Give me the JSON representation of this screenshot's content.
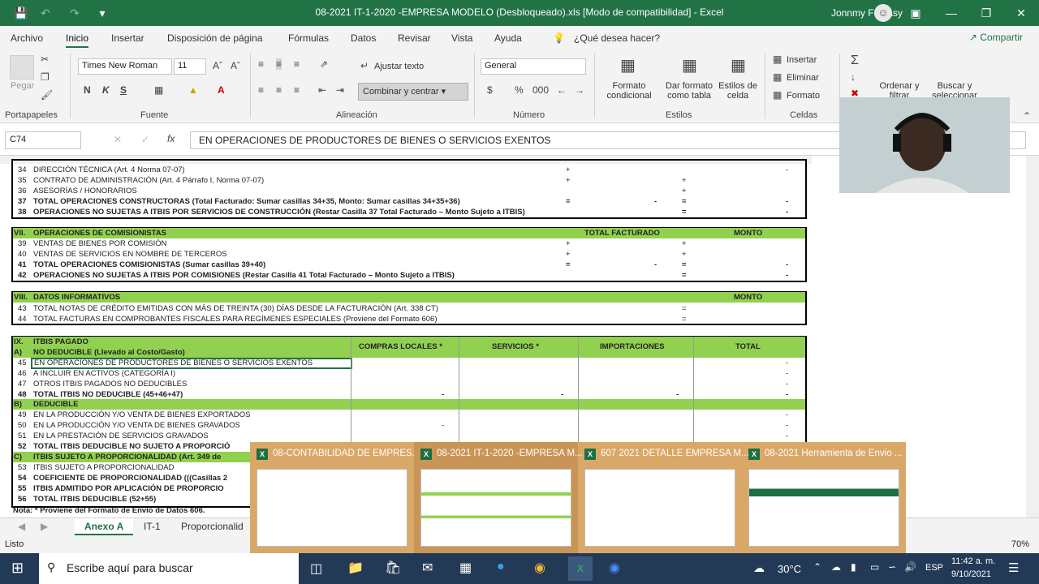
{
  "window": {
    "title": "08-2021 IT-1-2020 -EMPRESA MODELO  (Desbloqueado).xls  [Modo de compatibilidad]  -  Excel",
    "user": "Jonnmy Fantasy"
  },
  "menu": {
    "tabs": [
      "Archivo",
      "Inicio",
      "Insertar",
      "Disposición de página",
      "Fórmulas",
      "Datos",
      "Revisar",
      "Vista",
      "Ayuda"
    ],
    "active": "Inicio",
    "tell_me": "¿Qué desea hacer?",
    "share": "Compartir"
  },
  "ribbon": {
    "clipboard": {
      "paste": "Pegar",
      "label": "Portapapeles"
    },
    "font": {
      "name": "Times New Roman",
      "size": "11",
      "label": "Fuente",
      "bold": "N",
      "italic": "K",
      "underline": "S"
    },
    "alignment": {
      "wrap": "Ajustar texto",
      "merge": "Combinar y centrar",
      "label": "Alineación"
    },
    "number": {
      "format": "General",
      "label": "Número",
      "currency": "$",
      "percent": "%",
      "thousands": "000"
    },
    "styles": {
      "conditional": "Formato condicional",
      "table": "Dar formato como tabla",
      "cell": "Estilos de celda",
      "label": "Estilos"
    },
    "cells": {
      "insert": "Insertar",
      "delete": "Eliminar",
      "format": "Formato",
      "label": "Celdas"
    },
    "editing": {
      "sort": "Ordenar y filtrar",
      "find": "Buscar y seleccionar"
    }
  },
  "formula_bar": {
    "name_box": "C74",
    "content": "EN OPERACIONES DE PRODUCTORES DE BIENES O SERVICIOS EXENTOS"
  },
  "sheet_rows": {
    "r34": {
      "n": "34",
      "t": "DIRECCIÓN TÉCNICA (Art. 4 Norma 07-07)",
      "op": "+",
      "dash": "-"
    },
    "r35": {
      "n": "35",
      "t": "CONTRATO DE ADMINISTRACIÓN (Art. 4 Párrafo I, Norma 07-07)",
      "op": "+"
    },
    "r36": {
      "n": "36",
      "t": "ASESORÍAS / HONORARIOS",
      "op": "+"
    },
    "r37": {
      "n": "37",
      "t": "TOTAL OPERACIONES CONSTRUCTORAS (Total Facturado: Sumar casillas 34+35, Monto: Sumar casillas 34+35+36)",
      "op": "=",
      "dash": "-"
    },
    "r38": {
      "n": "38",
      "t": "OPERACIONES NO SUJETAS A ITBIS POR SERVICIOS DE CONSTRUCCIÓN (Restar Casilla 37 Total Facturado – Monto Sujeto a ITBIS)",
      "op": "=",
      "dash": "-"
    },
    "sec7": {
      "roman": "VII.",
      "t": "OPERACIONES DE COMISIONISTAS",
      "h1": "TOTAL FACTURADO",
      "h2": "MONTO"
    },
    "r39": {
      "n": "39",
      "t": "VENTAS DE BIENES POR COMISIÓN",
      "op": "+"
    },
    "r40": {
      "n": "40",
      "t": "VENTAS DE SERVICIOS EN NOMBRE DE TERCEROS",
      "op": "+"
    },
    "r41": {
      "n": "41",
      "t": "TOTAL OPERACIONES COMISIONISTAS (Sumar casillas 39+40)",
      "op": "=",
      "dash": "-"
    },
    "r42": {
      "n": "42",
      "t": "OPERACIONES NO SUJETAS A ITBIS POR COMISIONES (Restar Casilla 41 Total Facturado – Monto Sujeto a ITBIS)",
      "op": "=",
      "dash": "-"
    },
    "sec8": {
      "roman": "VIII.",
      "t": "DATOS INFORMATIVOS",
      "h": "MONTO"
    },
    "r43": {
      "n": "43",
      "t": "TOTAL NOTAS DE CRÉDITO EMITIDAS CON MÁS DE TREINTA (30) DÍAS DESDE LA FACTURACIÓN (Art. 338 CT)",
      "op": "="
    },
    "r44": {
      "n": "44",
      "t": "TOTAL FACTURAS EN COMPROBANTES FISCALES PARA REGÍMENES ESPECIALES (Proviene del Formato 606)",
      "op": "="
    },
    "sec9": {
      "roman": "IX.",
      "t": "ITBIS PAGADO",
      "h1": "COMPRAS LOCALES *",
      "h2": "SERVICIOS *",
      "h3": "IMPORTACIONES",
      "h4": "TOTAL"
    },
    "secA": {
      "l": "A)",
      "t": "NO DEDUCIBLE (Llevado al Costo/Gasto)"
    },
    "r45": {
      "n": "45",
      "t": "EN OPERACIONES DE PRODUCTORES DE BIENES O SERVICIOS EXENTOS",
      "dash": "-"
    },
    "r46": {
      "n": "46",
      "t": "A INCLUIR EN ACTIVOS (CATEGORÍA I)",
      "dash": "-"
    },
    "r47": {
      "n": "47",
      "t": "OTROS ITBIS PAGADOS NO DEDUCIBLES",
      "dash": "-"
    },
    "r48": {
      "n": "48",
      "t": "TOTAL ITBIS NO DEDUCIBLE (45+46+47)",
      "dash": "-"
    },
    "secB": {
      "l": "B)",
      "t": "DEDUCIBLE"
    },
    "r49": {
      "n": "49",
      "t": "EN LA PRODUCCIÓN Y/O VENTA DE BIENES EXPORTADOS",
      "dash": "-"
    },
    "r50": {
      "n": "50",
      "t": "EN LA PRODUCCIÓN Y/O VENTA DE BIENES GRAVADOS",
      "dash": "-"
    },
    "r51": {
      "n": "51",
      "t": "EN LA PRESTACIÓN DE SERVICIOS GRAVADOS",
      "dash": "-"
    },
    "r52": {
      "n": "52",
      "t": "TOTAL ITBIS DEDUCIBLE NO SUJETO A PROPORCIÓ"
    },
    "secC": {
      "l": "C)",
      "t": "ITBIS SUJETO A PROPORCIONALIDAD (Art. 349 de"
    },
    "r53": {
      "n": "53",
      "t": "ITBIS SUJETO A PROPORCIONALIDAD"
    },
    "r54": {
      "n": "54",
      "t": "COEFICIENTE DE PROPORCIONALIDAD (((Casillas 2"
    },
    "r55": {
      "n": "55",
      "t": "ITBIS ADMITIDO POR APLICACIÓN DE PROPORCIO"
    },
    "r56": {
      "n": "56",
      "t": "TOTAL ITBIS DEDUCIBLE (52+55)"
    },
    "note": "Nota: * Proviene del Formato de Envío de Datos 606."
  },
  "sheet_tabs": [
    "Anexo A",
    "IT-1",
    "Proporcionalid"
  ],
  "status": {
    "text": "Listo",
    "zoom": "70%"
  },
  "thumbnails": [
    {
      "title": "08-CONTABILIDAD DE EMPRES..."
    },
    {
      "title": "08-2021 IT-1-2020 -EMPRESA M..."
    },
    {
      "title": "607 2021 DETALLE EMPRESA M..."
    },
    {
      "title": "08-2021 Herramienta de Envio ..."
    }
  ],
  "taskbar": {
    "search": "Escribe aquí para buscar",
    "temp": "30°C",
    "lang": "ESP",
    "time": "11:42 a. m.",
    "date": "9/10/2021"
  }
}
